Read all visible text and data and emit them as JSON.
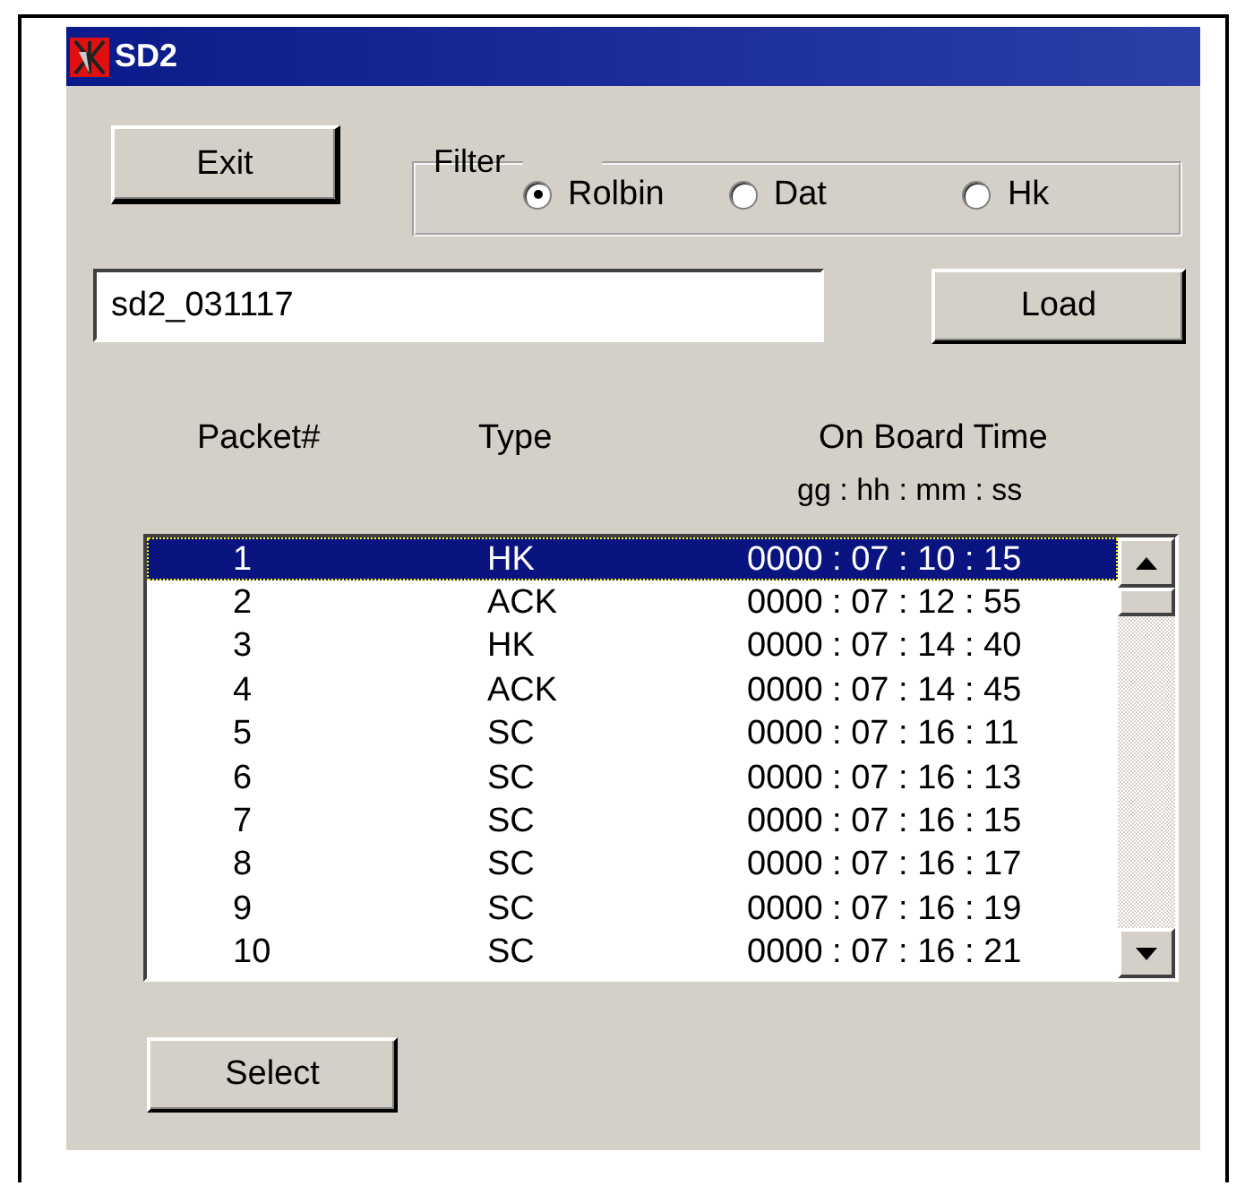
{
  "window": {
    "title": "SD2"
  },
  "exit_button": "Exit",
  "filter": {
    "label": "Filter",
    "options": [
      {
        "label": "Rolbin",
        "selected": true
      },
      {
        "label": "Dat",
        "selected": false
      },
      {
        "label": "Hk",
        "selected": false
      }
    ]
  },
  "file_field": {
    "value": "sd2_031117"
  },
  "load_button": "Load",
  "columns": [
    "Packet#",
    "Type",
    "On Board Time"
  ],
  "time_format": "gg : hh : mm : ss",
  "rows": [
    {
      "packet": "1",
      "type": "HK",
      "time": "0000 : 07 : 10 : 15",
      "selected": true
    },
    {
      "packet": "2",
      "type": "ACK",
      "time": "0000 : 07 : 12 : 55",
      "selected": false
    },
    {
      "packet": "3",
      "type": "HK",
      "time": "0000 : 07 : 14 : 40",
      "selected": false
    },
    {
      "packet": "4",
      "type": "ACK",
      "time": "0000 : 07 : 14 : 45",
      "selected": false
    },
    {
      "packet": "5",
      "type": "SC",
      "time": "0000 : 07 : 16 : 11",
      "selected": false
    },
    {
      "packet": "6",
      "type": "SC",
      "time": "0000 : 07 : 16 : 13",
      "selected": false
    },
    {
      "packet": "7",
      "type": "SC",
      "time": "0000 : 07 : 16 : 15",
      "selected": false
    },
    {
      "packet": "8",
      "type": "SC",
      "time": "0000 : 07 : 16 : 17",
      "selected": false
    },
    {
      "packet": "9",
      "type": "SC",
      "time": "0000 : 07 : 16 : 19",
      "selected": false
    },
    {
      "packet": "10",
      "type": "SC",
      "time": "0000 : 07 : 16 : 21",
      "selected": false
    }
  ],
  "select_button": "Select"
}
